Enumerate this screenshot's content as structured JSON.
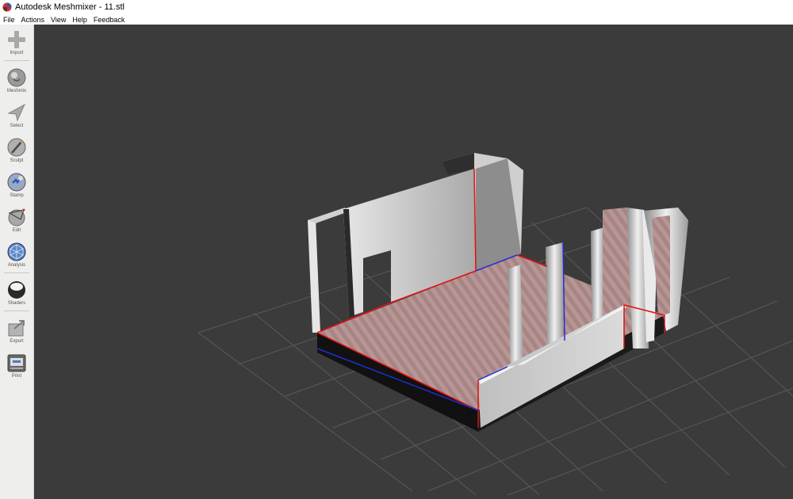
{
  "window": {
    "title": "Autodesk Meshmixer - 11.stl"
  },
  "menu": {
    "items": [
      "File",
      "Actions",
      "View",
      "Help",
      "Feedback"
    ]
  },
  "toolbar": {
    "tools": [
      {
        "label": "Import",
        "icon": "plus-icon"
      },
      {
        "label": "Meshmix",
        "icon": "meshmix-icon"
      },
      {
        "label": "Select",
        "icon": "select-arrow-icon"
      },
      {
        "label": "Sculpt",
        "icon": "sculpt-brush-icon"
      },
      {
        "label": "Stamp",
        "icon": "stamp-icon"
      },
      {
        "label": "Edit",
        "icon": "edit-icon"
      },
      {
        "label": "Analysis",
        "icon": "analysis-icon"
      },
      {
        "label": "Shaders",
        "icon": "shaders-icon"
      },
      {
        "label": "Export",
        "icon": "export-icon"
      },
      {
        "label": "Print",
        "icon": "print-icon"
      }
    ]
  },
  "viewport": {
    "background": "#3b3b3b",
    "grid_color": "#5a5a5a",
    "boundary_edge_color": "#e01010",
    "alt_edge_color": "#2030d0",
    "floor_color": "#b79494",
    "wall_color": "#c6c6c6"
  }
}
